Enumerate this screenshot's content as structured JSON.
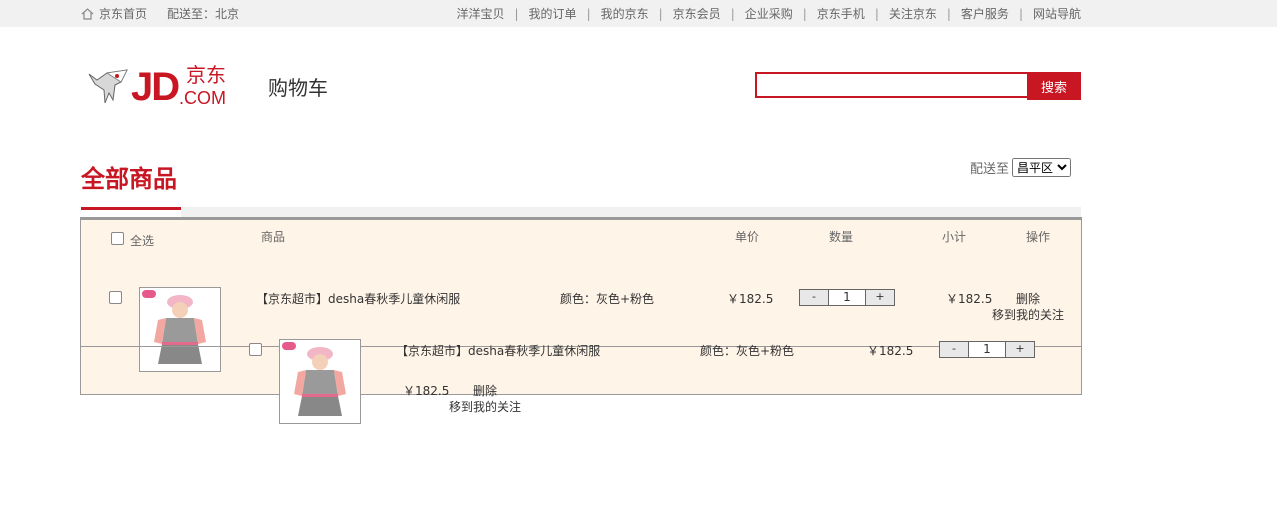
{
  "topbar": {
    "home": "京东首页",
    "location": "配送至：北京",
    "links": [
      "洋洋宝贝",
      "我的订单",
      "我的京东",
      "京东会员",
      "企业采购",
      "京东手机",
      "关注京东",
      "客户服务",
      "网站导航"
    ]
  },
  "header": {
    "logo_text": "JD.京东 .COM",
    "page_title": "购物车",
    "search_value": "",
    "search_button": "搜索"
  },
  "cart_title": "全部商品",
  "deliver": {
    "label": "配送至",
    "selected": "昌平区"
  },
  "table_headers": {
    "select_all": "全选",
    "product": "商品",
    "unit_price": "单价",
    "quantity": "数量",
    "subtotal": "小计",
    "actions": "操作"
  },
  "items": [
    {
      "name": "【京东超市】desha春秋季儿童休闲服",
      "attrs": "颜色：灰色+粉色",
      "price": "￥182.5",
      "qty": "1",
      "subtotal": "￥182.5",
      "delete": "删除",
      "move_to_favorites": "移到我的关注"
    },
    {
      "name": "【京东超市】desha春秋季儿童休闲服",
      "attrs": "颜色：灰色+粉色",
      "price": "￥182.5",
      "qty": "1",
      "subtotal": "￥182.5",
      "delete": "删除",
      "move_to_favorites": "移到我的关注"
    }
  ],
  "qty_controls": {
    "minus": "-",
    "plus": "+"
  }
}
